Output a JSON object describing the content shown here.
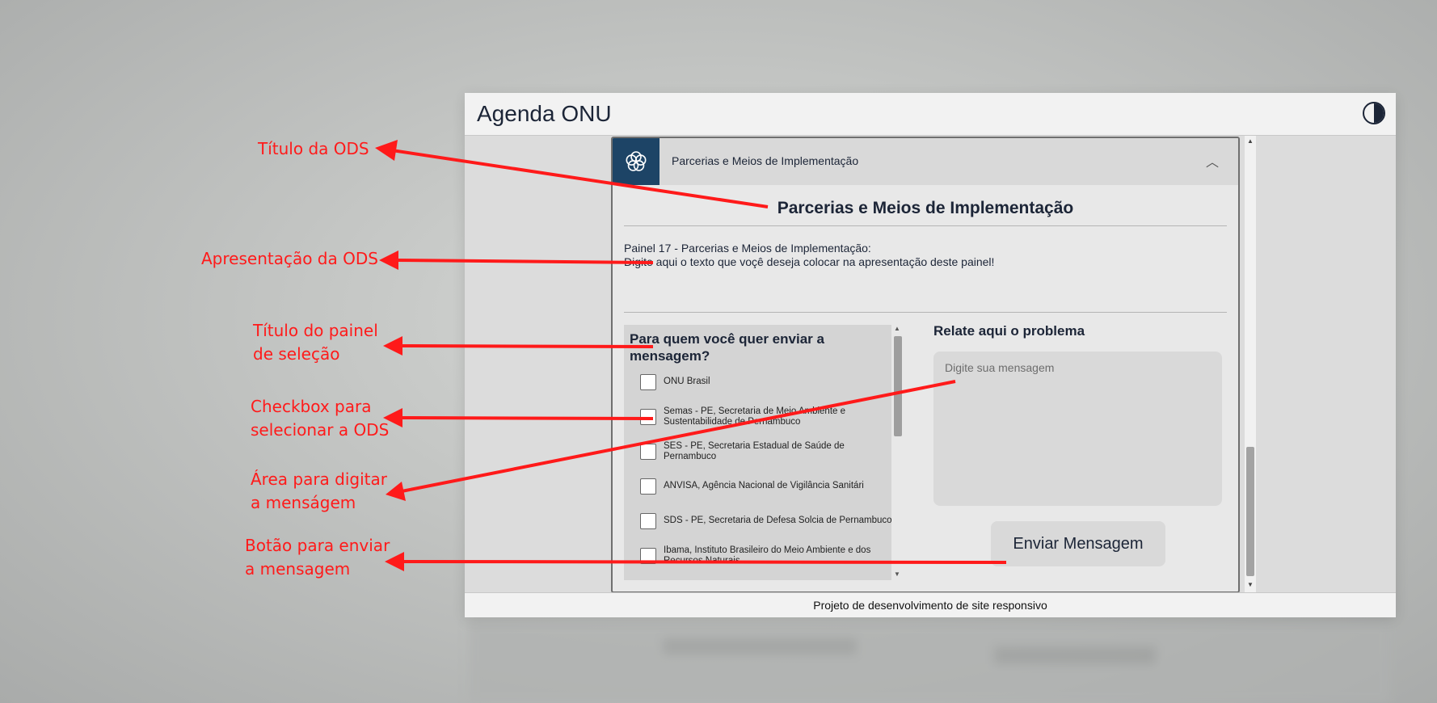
{
  "app": {
    "title": "Agenda ONU",
    "footer": "Projeto de desenvolvimento de site responsivo",
    "icons": {
      "theme_toggle": "contrast-icon"
    }
  },
  "panel": {
    "header_label": "Parcerias e Meios de Implementação",
    "expanded": true,
    "title": "Parcerias e Meios de Implementação",
    "intro_line1": "Painel 17 - Parcerias e Meios de Implementação:",
    "intro_line2": "Digite aqui o texto que voçê deseja colocar na apresentação deste painel!"
  },
  "selection": {
    "title": "Para quem você quer enviar a mensagem?",
    "options": [
      {
        "label": "ONU Brasil",
        "checked": false
      },
      {
        "label": "Semas - PE, Secretaria de Meio Ambiente e Sustentabilidade de Pernambuco",
        "checked": false
      },
      {
        "label": "SES - PE, Secretaria Estadual de Saúde de Pernambuco",
        "checked": false
      },
      {
        "label": "ANVISA, Agência Nacional de Vigilância Sanitári",
        "checked": false
      },
      {
        "label": "SDS - PE, Secretaria de Defesa Solcia de Pernambuco",
        "checked": false
      },
      {
        "label": "Ibama, Instituto Brasileiro do Meio Ambiente e dos Recursos Naturais",
        "checked": false
      }
    ]
  },
  "message": {
    "title": "Relate aqui o problema",
    "placeholder": "Digite sua mensagem",
    "value": "",
    "send_label": "Enviar Mensagem"
  },
  "annotations": {
    "color": "#ff1a1a",
    "titulo_ods": "Título da ODS",
    "apresentacao_ods": "Apresentação da ODS",
    "titulo_painel_1": "Título do painel",
    "titulo_painel_2": "de seleção",
    "checkbox_1": "Checkbox para",
    "checkbox_2": "selecionar a ODS",
    "area_1": "Área para digitar",
    "area_2": "a menságem",
    "botao_1": "Botão para enviar",
    "botao_2": "a mensagem"
  },
  "colors": {
    "brand_dark": "#1c2537",
    "logo_bg": "#1d4466",
    "panel_bg": "#e8e8e8",
    "annotation": "#ff1a1a"
  }
}
